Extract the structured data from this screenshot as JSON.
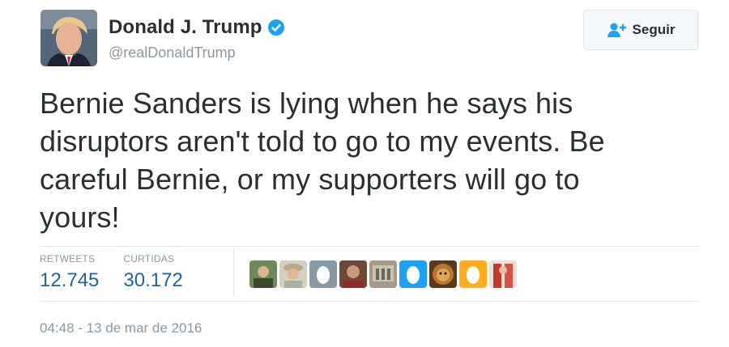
{
  "user": {
    "name": "Donald J. Trump",
    "handle": "@realDonaldTrump"
  },
  "follow_button": {
    "label": "Seguir"
  },
  "tweet": {
    "lines": [
      "Bernie Sanders is lying when he says his",
      "disruptors aren't told to go to my events. Be",
      "careful Bernie, or my supporters will go to",
      "yours!"
    ]
  },
  "stats": {
    "retweets_label": "RETWEETS",
    "retweets_value": "12.745",
    "likes_label": "CURTIDAS",
    "likes_value": "30.172"
  },
  "timestamp": "04:48 - 13 de mar de 2016",
  "colors": {
    "verified": "#1da1f2",
    "stat_value": "#1b6898",
    "muted": "#8899a6",
    "default_avatar": "#ffad1f",
    "default_avatar_blue": "#1da1f2"
  }
}
